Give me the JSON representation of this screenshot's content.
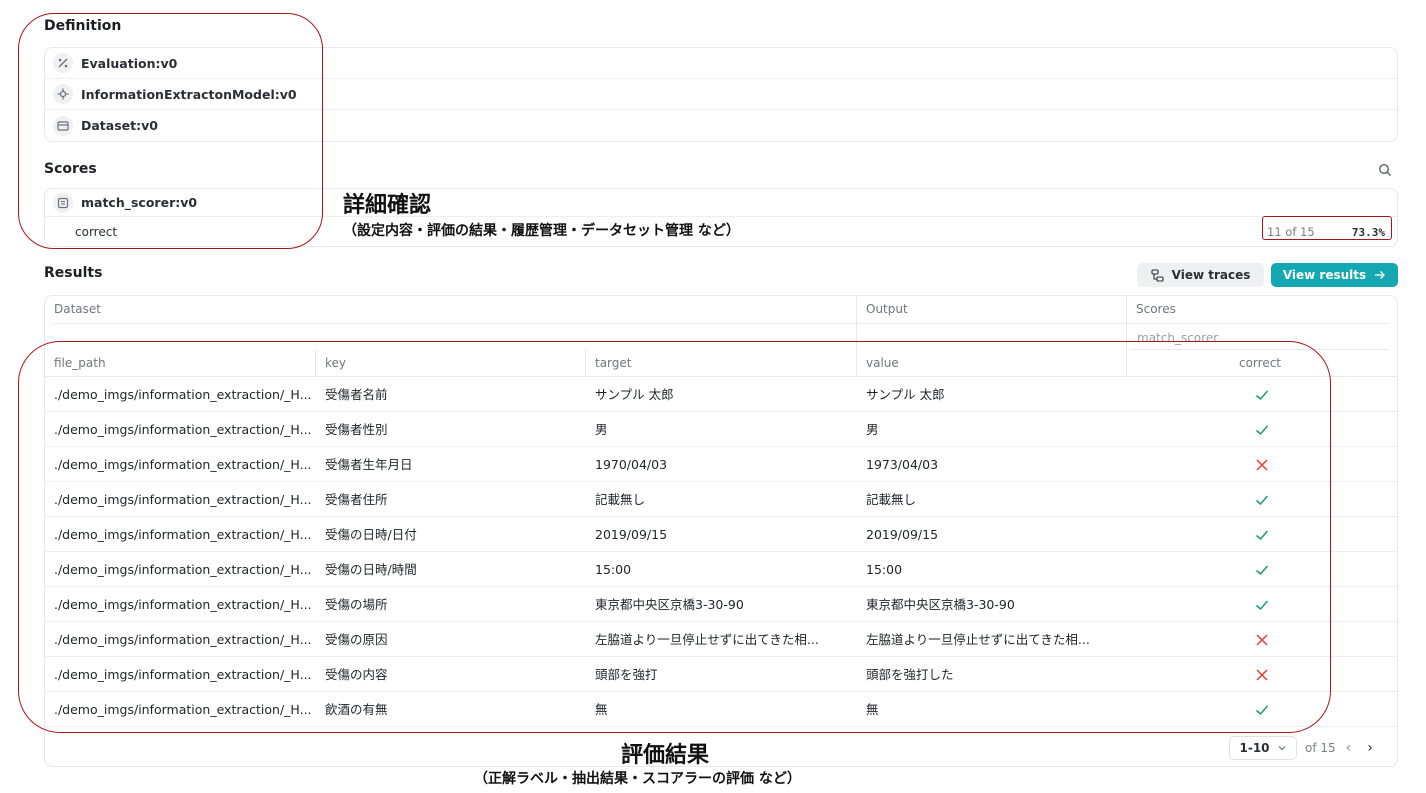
{
  "definition": {
    "title": "Definition",
    "items": [
      {
        "label": "Evaluation:v0",
        "icon": "percent-icon"
      },
      {
        "label": "InformationExtractonModel:v0",
        "icon": "model-icon"
      },
      {
        "label": "Dataset:v0",
        "icon": "table-icon"
      }
    ]
  },
  "scores": {
    "title": "Scores",
    "scorer": "match_scorer:v0",
    "metric": "correct",
    "count": "11 of 15",
    "percent": "73.3%"
  },
  "results": {
    "title": "Results",
    "view_traces": "View traces",
    "view_results": "View results",
    "groups": {
      "dataset": "Dataset",
      "output": "Output",
      "scores": "Scores"
    },
    "scorer_group": "match_scorer",
    "columns": [
      "file_path",
      "key",
      "target",
      "value",
      "correct"
    ],
    "rows": [
      {
        "file_path": "./demo_imgs/information_extraction/_H...",
        "key": "受傷者名前",
        "target": "サンプル 太郎",
        "value": "サンプル 太郎",
        "correct": true
      },
      {
        "file_path": "./demo_imgs/information_extraction/_H...",
        "key": "受傷者性別",
        "target": "男",
        "value": "男",
        "correct": true
      },
      {
        "file_path": "./demo_imgs/information_extraction/_H...",
        "key": "受傷者生年月日",
        "target": "1970/04/03",
        "value": "1973/04/03",
        "correct": false
      },
      {
        "file_path": "./demo_imgs/information_extraction/_H...",
        "key": "受傷者住所",
        "target": "記載無し",
        "value": "記載無し",
        "correct": true
      },
      {
        "file_path": "./demo_imgs/information_extraction/_H...",
        "key": "受傷の日時/日付",
        "target": "2019/09/15",
        "value": "2019/09/15",
        "correct": true
      },
      {
        "file_path": "./demo_imgs/information_extraction/_H...",
        "key": "受傷の日時/時間",
        "target": "15:00",
        "value": "15:00",
        "correct": true
      },
      {
        "file_path": "./demo_imgs/information_extraction/_H...",
        "key": "受傷の場所",
        "target": "東京都中央区京橋3-30-90",
        "value": "東京都中央区京橋3-30-90",
        "correct": true
      },
      {
        "file_path": "./demo_imgs/information_extraction/_H...",
        "key": "受傷の原因",
        "target": "左脇道より一旦停止せずに出てきた相...",
        "value": "左脇道より一旦停止せずに出てきた相...",
        "correct": false
      },
      {
        "file_path": "./demo_imgs/information_extraction/_H...",
        "key": "受傷の内容",
        "target": "頭部を強打",
        "value": "頭部を強打した",
        "correct": false
      },
      {
        "file_path": "./demo_imgs/information_extraction/_H...",
        "key": "飲酒の有無",
        "target": "無",
        "value": "無",
        "correct": true
      }
    ],
    "pagination": {
      "range": "1-10",
      "of": "of 15"
    }
  },
  "annotations": {
    "detail_title": "詳細確認",
    "detail_sub": "（設定内容・評価の結果・履歴管理・データセット管理 など）",
    "result_title": "評価結果",
    "result_sub": "（正解ラベル・抽出結果・スコアラーの評価 など）"
  },
  "colors": {
    "accent": "#13a8b2",
    "check": "#1a9a6c",
    "cross": "#e0403a",
    "annotation": "#a3171d"
  }
}
